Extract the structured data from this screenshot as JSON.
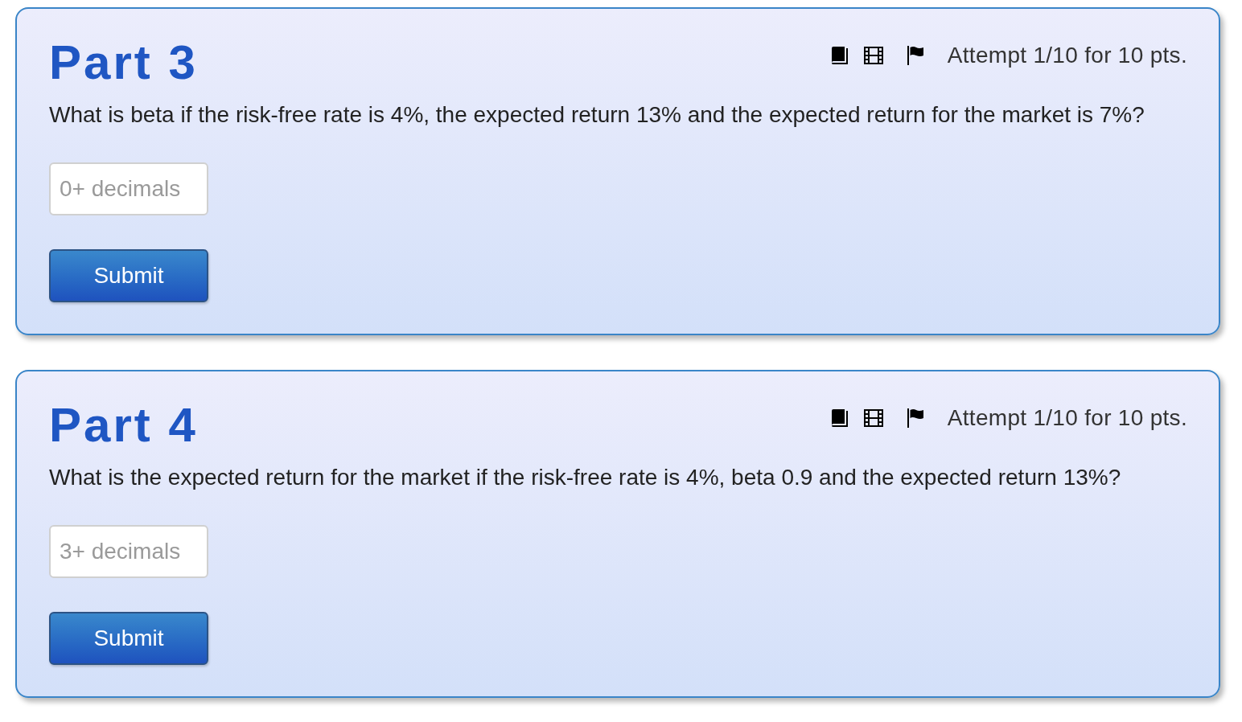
{
  "parts": [
    {
      "title": "Part 3",
      "attempt": "Attempt 1/10 for 10 pts.",
      "question": "What is beta if the risk-free rate is 4%, the expected return 13% and the expected return for the market is 7%?",
      "answer": {
        "placeholder": "0+ decimals"
      },
      "submit": "Submit"
    },
    {
      "title": "Part 4",
      "attempt": "Attempt 1/10 for 10 pts.",
      "question": "What is the expected return for the market if the risk-free rate is 4%, beta 0.9 and the expected return 13%?",
      "answer": {
        "placeholder": "3+ decimals"
      },
      "submit": "Submit"
    }
  ]
}
